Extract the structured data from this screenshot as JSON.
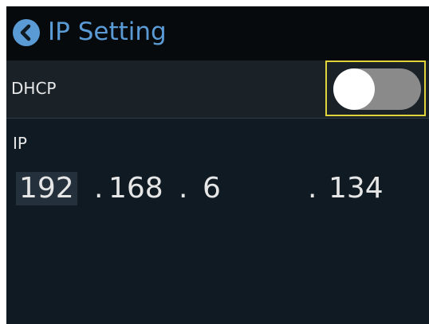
{
  "header": {
    "title": "IP Setting",
    "back_icon": "chevron-left-icon",
    "accent_color": "#5b9bd5"
  },
  "dhcp": {
    "label": "DHCP",
    "enabled": false,
    "focus_color": "#e0d43a"
  },
  "ip": {
    "label": "IP",
    "octets": [
      "192",
      "168",
      "6",
      "134"
    ],
    "separator": ".",
    "selected_octet_index": 0
  }
}
